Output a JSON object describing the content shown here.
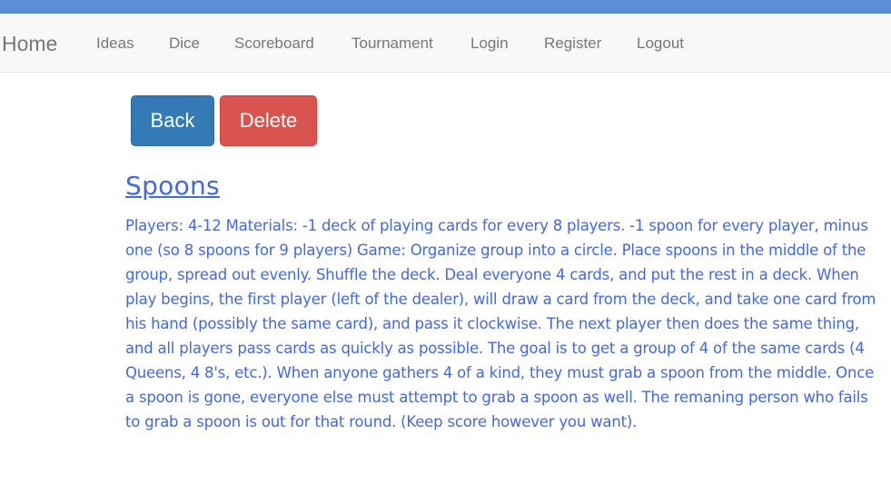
{
  "nav": {
    "brand": "Home",
    "links": [
      "Ideas",
      "Dice",
      "Scoreboard",
      "Tournament",
      "Login",
      "Register",
      "Logout"
    ]
  },
  "actions": {
    "back_label": "Back",
    "delete_label": "Delete"
  },
  "idea": {
    "title": "Spoons",
    "description": "Players: 4-12 Materials: -1 deck of playing cards for every 8 players. -1 spoon for every player, minus one (so 8 spoons for 9 players) Game: Organize group into a circle. Place spoons in the middle of the group, spread out evenly. Shuffle the deck. Deal everyone 4 cards, and put the rest in a deck. When play begins, the first player (left of the dealer), will draw a card from the deck, and take one card from his hand (possibly the same card), and pass it clockwise. The next player then does the same thing, and all players pass cards as quickly as possible. The goal is to get a group of 4 of the same cards (4 Queens, 4 8's, etc.). When anyone gathers 4 of a kind, they must grab a spoon from the middle. Once a spoon is gone, everyone else must attempt to grab a spoon as well. The remaning person who fails to grab a spoon is out for that round. (Keep score however you want)."
  },
  "colors": {
    "top_stripe": "#5a8fd8",
    "navbar_bg": "#f8f8f8",
    "nav_text": "#777777",
    "back_button": "#337ab7",
    "delete_button": "#d9534f",
    "content_text": "#4169e1"
  }
}
